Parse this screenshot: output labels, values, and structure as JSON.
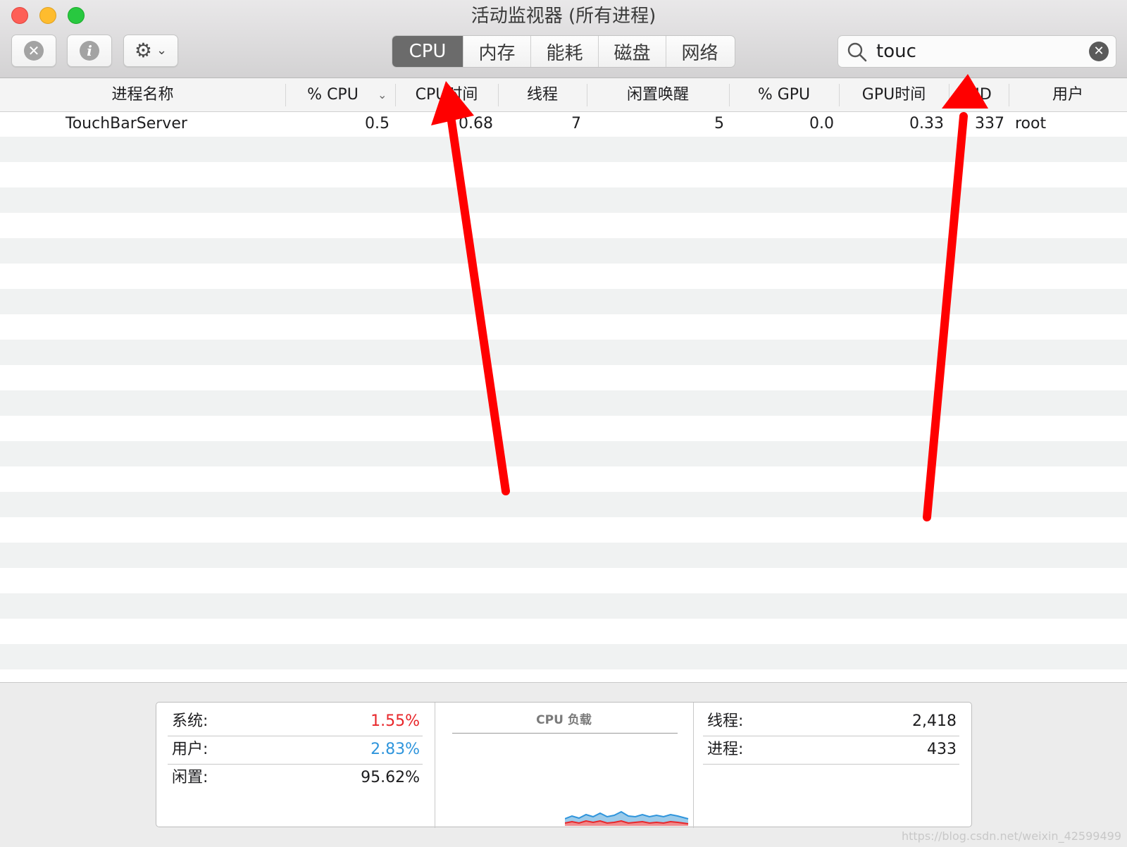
{
  "window": {
    "title": "活动监视器 (所有进程)"
  },
  "toolbar": {
    "tabs": [
      {
        "label": "CPU",
        "active": true
      },
      {
        "label": "内存",
        "active": false
      },
      {
        "label": "能耗",
        "active": false
      },
      {
        "label": "磁盘",
        "active": false
      },
      {
        "label": "网络",
        "active": false
      }
    ],
    "search": {
      "value": "touc"
    }
  },
  "table": {
    "columns": [
      "进程名称",
      "% CPU",
      "CPU时间",
      "线程",
      "闲置唤醒",
      "% GPU",
      "GPU时间",
      "PID",
      "用户"
    ],
    "rows": [
      {
        "name": "TouchBarServer",
        "cpu": "0.5",
        "cpu_time": "0.68",
        "threads": "7",
        "idle_wakeups": "5",
        "gpu": "0.0",
        "gpu_time": "0.33",
        "pid": "337",
        "user": "root"
      }
    ]
  },
  "summary": {
    "system_label": "系统:",
    "system_value": "1.55%",
    "user_label": "用户:",
    "user_value": "2.83%",
    "idle_label": "闲置:",
    "idle_value": "95.62%",
    "load_title": "CPU 负载",
    "threads_label": "线程:",
    "threads_value": "2,418",
    "processes_label": "进程:",
    "processes_value": "433"
  },
  "colors": {
    "system": "#e8262a",
    "user": "#2f95dc",
    "arrow": "#ff0000",
    "active_tab": "#6b6b6b"
  },
  "icons": [
    "stop-icon",
    "info-icon",
    "gear-icon",
    "chevron-down-icon",
    "search-icon",
    "clear-icon",
    "sort-chevron-icon"
  ],
  "watermark": "https://blog.csdn.net/weixin_42599499"
}
